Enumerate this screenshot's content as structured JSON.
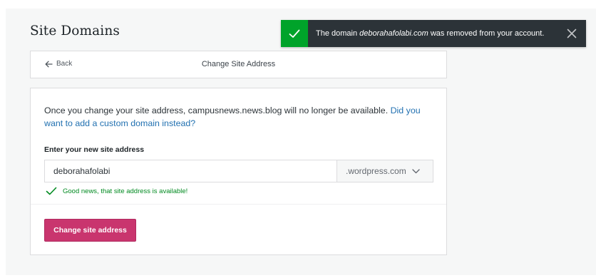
{
  "page": {
    "title": "Site Domains"
  },
  "header": {
    "back_label": "Back",
    "title": "Change Site Address"
  },
  "form": {
    "description_prefix": "Once you change your site address, campusnews.news.blog will no longer be available.",
    "description_link": "Did you want to add a custom domain instead?",
    "field_label": "Enter your new site address",
    "address_value": "deborahafolabi",
    "address_suffix": ".wordpress.com",
    "validation_message": "Good news, that site address is available!",
    "submit_label": "Change site address"
  },
  "toast": {
    "message_prefix": "The domain",
    "domain": "deborahafolabi.com",
    "message_suffix": "was removed from your account."
  },
  "colors": {
    "accent_pink": "#c9356e",
    "success_green": "#00a32a",
    "link_blue": "#2271b1",
    "toast_dark": "#2c3338"
  },
  "icons": {
    "back": "arrow-left-icon",
    "suffix_dropdown": "chevron-down-icon",
    "validation": "checkmark-icon",
    "toast_status": "checkmark-icon",
    "toast_dismiss": "close-icon"
  }
}
